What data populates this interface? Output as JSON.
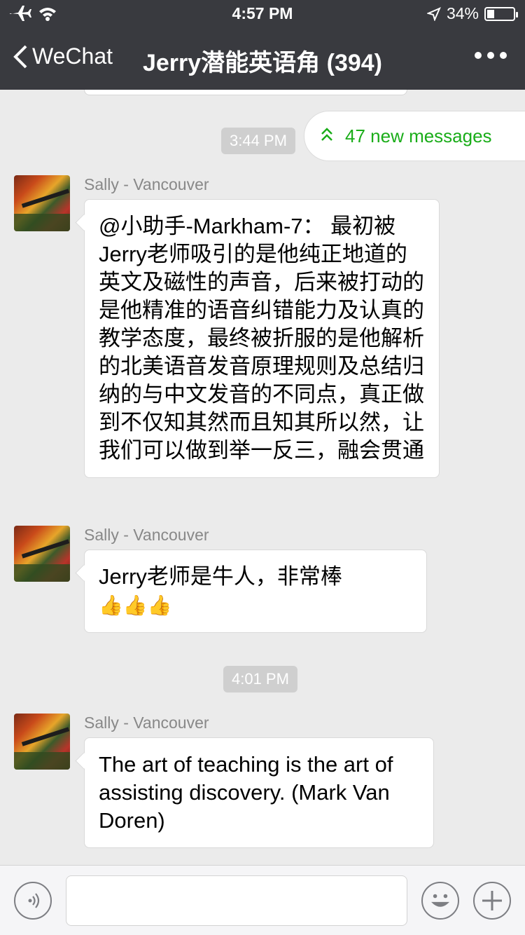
{
  "status_bar": {
    "time": "4:57 PM",
    "battery": "34%",
    "battery_level": 0.34
  },
  "nav": {
    "back_label": "WeChat",
    "title": "Jerry潜能英语角 (394)"
  },
  "new_messages": "47 new messages",
  "timestamps": [
    "3:44 PM",
    "4:01 PM"
  ],
  "messages": [
    {
      "sender": "Sally - Vancouver",
      "text": "@小助手-Markham-7： 最初被Jerry老师吸引的是他纯正地道的英文及磁性的声音，后来被打动的是他精准的语音纠错能力及认真的教学态度，最终被折服的是他解析的北美语音发音原理规则及总结归纳的与中文发音的不同点，真正做到不仅知其然而且知其所以然，让我们可以做到举一反三，融会贯通"
    },
    {
      "sender": "Sally - Vancouver",
      "text": "Jerry老师是牛人，非常棒",
      "emoji": "👍👍👍"
    },
    {
      "sender": "Sally - Vancouver",
      "text": "The art of teaching is the art of assisting discovery.  (Mark Van Doren)"
    }
  ]
}
